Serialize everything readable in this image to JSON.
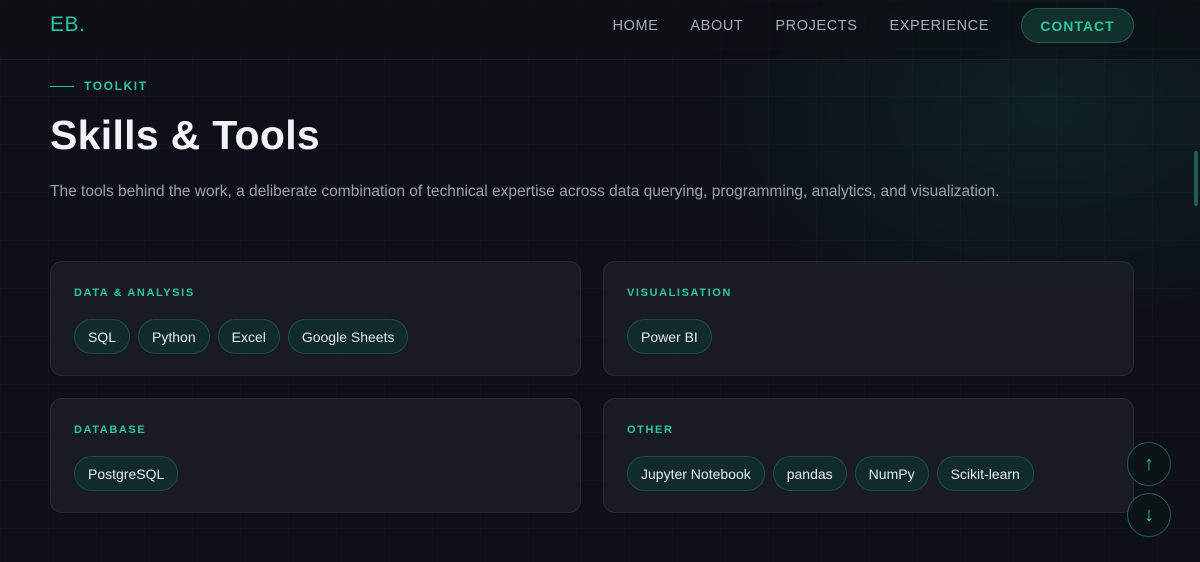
{
  "nav": {
    "logo": "EB.",
    "links": [
      "HOME",
      "ABOUT",
      "PROJECTS",
      "EXPERIENCE"
    ],
    "contact_label": "CONTACT"
  },
  "section": {
    "eyebrow": "TOOLKIT",
    "title": "Skills & Tools",
    "subtitle": "The tools behind the work, a deliberate combination of technical expertise across data querying, programming, analytics, and visualization."
  },
  "cards": [
    {
      "title": "DATA & ANALYSIS",
      "tags": [
        "SQL",
        "Python",
        "Excel",
        "Google Sheets"
      ]
    },
    {
      "title": "VISUALISATION",
      "tags": [
        "Power BI"
      ]
    },
    {
      "title": "DATABASE",
      "tags": [
        "PostgreSQL"
      ]
    },
    {
      "title": "OTHER",
      "tags": [
        "Jupyter Notebook",
        "pandas",
        "NumPy",
        "Scikit-learn"
      ]
    }
  ],
  "scroll_buttons": {
    "up_icon": "arrow-up-icon",
    "up_glyph": "↑",
    "down_icon": "arrow-down-icon",
    "down_glyph": "↓"
  },
  "colors": {
    "accent": "#2bc4a4",
    "background": "#0d1016",
    "card": "#191d24",
    "tag_bg": "#112a2a"
  }
}
